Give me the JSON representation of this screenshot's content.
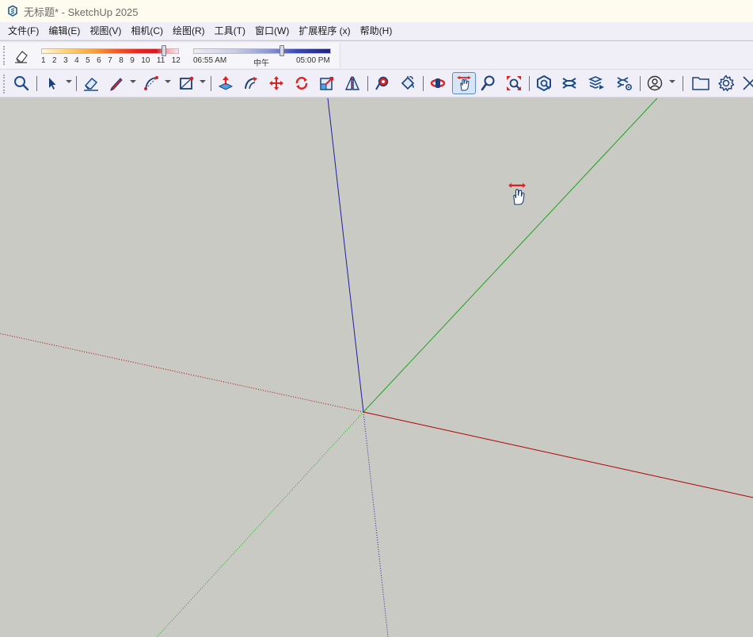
{
  "window": {
    "title": "无标题* - SketchUp 2025",
    "icon": "sketchup-logo-icon"
  },
  "menu": {
    "items": [
      {
        "label": "文件(F)"
      },
      {
        "label": "编辑(E)"
      },
      {
        "label": "视图(V)"
      },
      {
        "label": "相机(C)"
      },
      {
        "label": "绘图(R)"
      },
      {
        "label": "工具(T)"
      },
      {
        "label": "窗口(W)"
      },
      {
        "label": "扩展程序 (x)"
      },
      {
        "label": "帮助(H)"
      }
    ]
  },
  "shadows": {
    "eraser_icon": "eraser-icon",
    "month_labels": [
      "1",
      "2",
      "3",
      "4",
      "5",
      "6",
      "7",
      "8",
      "9",
      "10",
      "11",
      "12"
    ],
    "month_value": 11,
    "time_start": "06:55 AM",
    "time_mid": "中午",
    "time_end": "05:00 PM",
    "time_fraction": 0.65
  },
  "toolbar": {
    "tools": [
      {
        "name": "search-icon"
      },
      {
        "name": "select-arrow-icon"
      },
      {
        "name": "eraser-icon"
      },
      {
        "name": "pencil-icon"
      },
      {
        "name": "arc-icon"
      },
      {
        "name": "rectangle-icon"
      },
      {
        "name": "push-pull-icon"
      },
      {
        "name": "follow-me-icon"
      },
      {
        "name": "move-icon"
      },
      {
        "name": "rotate-icon"
      },
      {
        "name": "scale-icon"
      },
      {
        "name": "flip-icon"
      },
      {
        "name": "tape-measure-icon"
      },
      {
        "name": "paint-bucket-icon"
      },
      {
        "name": "orbit-icon"
      },
      {
        "name": "pan-icon",
        "active": true
      },
      {
        "name": "zoom-icon"
      },
      {
        "name": "zoom-extents-icon"
      },
      {
        "name": "3d-warehouse-icon"
      },
      {
        "name": "extension-warehouse-icon"
      },
      {
        "name": "layout-send-icon"
      },
      {
        "name": "extension-manager-icon"
      },
      {
        "name": "user-account-icon"
      },
      {
        "name": "folder-icon"
      },
      {
        "name": "gear-icon"
      },
      {
        "name": "close-icon"
      }
    ]
  },
  "colors": {
    "axis_red": "#b00000",
    "axis_green": "#1aa41a",
    "axis_blue": "#1e1ea0",
    "viewport_bg": "#cacac4",
    "accent_blue": "#1a5fb4"
  }
}
